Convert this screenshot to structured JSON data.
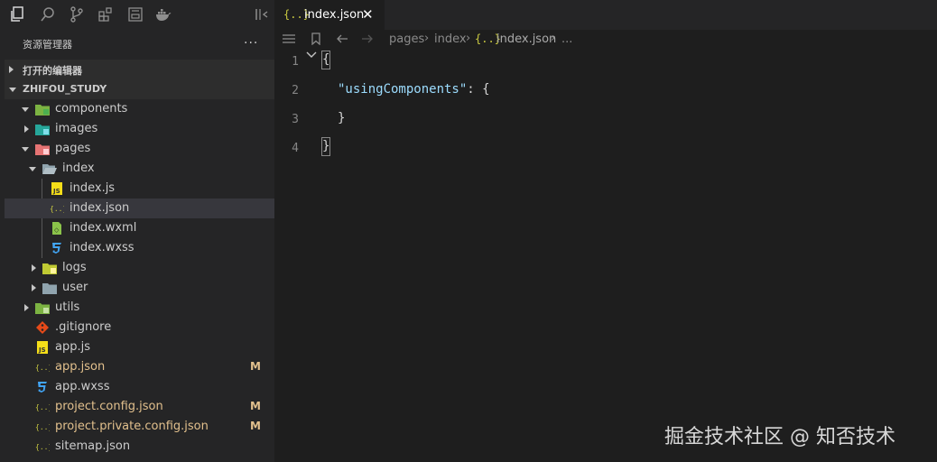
{
  "activity_bar": {
    "icons": [
      "files-icon",
      "search-icon",
      "source-control-icon",
      "extensions-icon",
      "remote-explorer-icon",
      "docker-icon",
      "collapse-panel-icon"
    ]
  },
  "explorer": {
    "title": "资源管理器",
    "more": "...",
    "open_editors_label": "打开的编辑器",
    "project_label": "ZHIFOU_STUDY",
    "items": [
      {
        "name": "components",
        "icon": "folder-components-icon",
        "kind": "folder-open"
      },
      {
        "name": "images",
        "icon": "folder-images-icon",
        "kind": "folder-closed"
      },
      {
        "name": "pages",
        "icon": "folder-pages-icon",
        "kind": "folder-open"
      },
      {
        "name": "index",
        "icon": "folder-open-icon",
        "kind": "folder-open"
      },
      {
        "name": "index.js",
        "icon": "js-file-icon",
        "kind": "file"
      },
      {
        "name": "index.json",
        "icon": "json-file-icon",
        "kind": "file",
        "selected": true
      },
      {
        "name": "index.wxml",
        "icon": "wxml-file-icon",
        "kind": "file"
      },
      {
        "name": "index.wxss",
        "icon": "css-file-icon",
        "kind": "file"
      },
      {
        "name": "logs",
        "icon": "folder-logs-icon",
        "kind": "folder-closed"
      },
      {
        "name": "user",
        "icon": "folder-icon",
        "kind": "folder-closed"
      },
      {
        "name": "utils",
        "icon": "folder-utils-icon",
        "kind": "folder-closed"
      },
      {
        "name": ".gitignore",
        "icon": "git-icon",
        "kind": "file"
      },
      {
        "name": "app.js",
        "icon": "js-file-icon",
        "kind": "file"
      },
      {
        "name": "app.json",
        "icon": "json-file-icon",
        "kind": "file",
        "status": "M"
      },
      {
        "name": "app.wxss",
        "icon": "css-file-icon",
        "kind": "file"
      },
      {
        "name": "project.config.json",
        "icon": "json-file-icon",
        "kind": "file",
        "status": "M"
      },
      {
        "name": "project.private.config.json",
        "icon": "json-file-icon",
        "kind": "file",
        "status": "M"
      },
      {
        "name": "sitemap.json",
        "icon": "json-file-icon",
        "kind": "file"
      }
    ]
  },
  "editor": {
    "tab": {
      "icon_text": "{..}",
      "label": "index.json",
      "close": "✕"
    },
    "breadcrumb": {
      "items": [
        "pages",
        "index",
        "index.json",
        "..."
      ],
      "file_icon_text": "{..}"
    },
    "lines": [
      {
        "number": "1",
        "text": "{"
      },
      {
        "number": "2",
        "text": "  \"usingComponents\": {"
      },
      {
        "number": "3",
        "text": "  }"
      },
      {
        "number": "4",
        "text": "}"
      }
    ],
    "code_parts": {
      "open_brace": "{",
      "property": "\"usingComponents\"",
      "colon": ": ",
      "inner_open": "{",
      "inner_close": "}",
      "close_brace": "}"
    }
  },
  "watermark": "掘金技术社区 @ 知否技术",
  "colors": {
    "editor_bg": "#1e1e1e",
    "sidebar_bg": "#252526",
    "selected_row": "#37373d",
    "modified": "#e2c08d",
    "json_icon": "#cbcb41",
    "property": "#9cdcfe"
  }
}
